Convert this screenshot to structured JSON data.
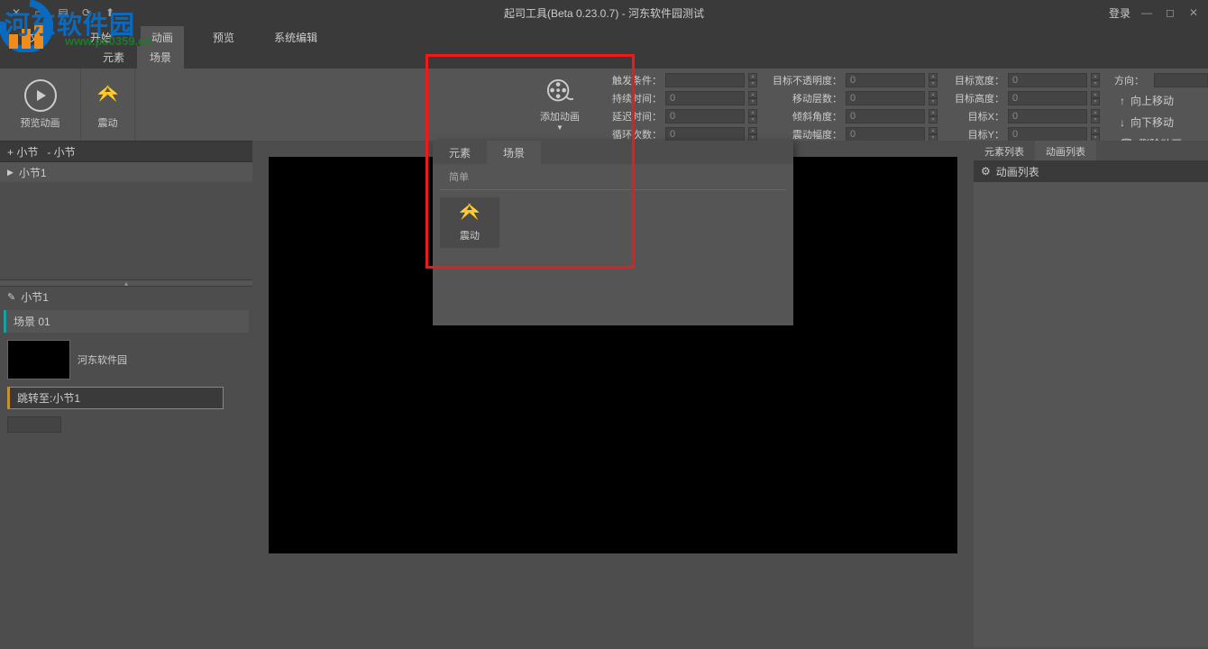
{
  "app": {
    "title": "起司工具(Beta 0.23.0.7) - 河东软件园测试",
    "login": "登录"
  },
  "watermark": {
    "text": "河东软件园",
    "url": "www.pc0359.cn"
  },
  "menu": {
    "file": "文件",
    "start": "开始",
    "animation": "动画",
    "preview": "预览",
    "sysedit": "系统编辑"
  },
  "subtabs": {
    "element": "元素",
    "scene": "场景"
  },
  "ribbon": {
    "preview_anim": "预览动画",
    "shake": "震动",
    "add_anim": "添加动画"
  },
  "props": {
    "trigger": {
      "label": "触发条件：",
      "value": ""
    },
    "duration": {
      "label": "持续时间：",
      "value": "0"
    },
    "delay": {
      "label": "延迟时间：",
      "value": "0"
    },
    "loops": {
      "label": "循环次数：",
      "value": "0"
    },
    "opacity": {
      "label": "目标不透明度：",
      "value": "0"
    },
    "layers": {
      "label": "移动层数：",
      "value": "0"
    },
    "tilt": {
      "label": "倾斜角度：",
      "value": "0"
    },
    "amplitude": {
      "label": "震动幅度：",
      "value": "0"
    },
    "twidth": {
      "label": "目标宽度：",
      "value": "0"
    },
    "theight": {
      "label": "目标高度：",
      "value": "0"
    },
    "tx": {
      "label": "目标X：",
      "value": "0"
    },
    "ty": {
      "label": "目标Y：",
      "value": "0"
    }
  },
  "direction": {
    "header": "方向：",
    "up": "向上移动",
    "down": "向下移动",
    "delete": "删除动画"
  },
  "sections": {
    "add": "+ 小节",
    "remove": "- 小节",
    "item1": "小节1"
  },
  "inspector": {
    "header": "小节1",
    "scene": "场景 01",
    "thumb_label": "河东软件园",
    "jump": "跳转至:小节1"
  },
  "rightpanel": {
    "tab_elements": "元素列表",
    "tab_anims": "动画列表",
    "header": "动画列表"
  },
  "dropdown": {
    "tab_element": "元素",
    "tab_scene": "场景",
    "category": "简单",
    "item_shake": "震动"
  }
}
